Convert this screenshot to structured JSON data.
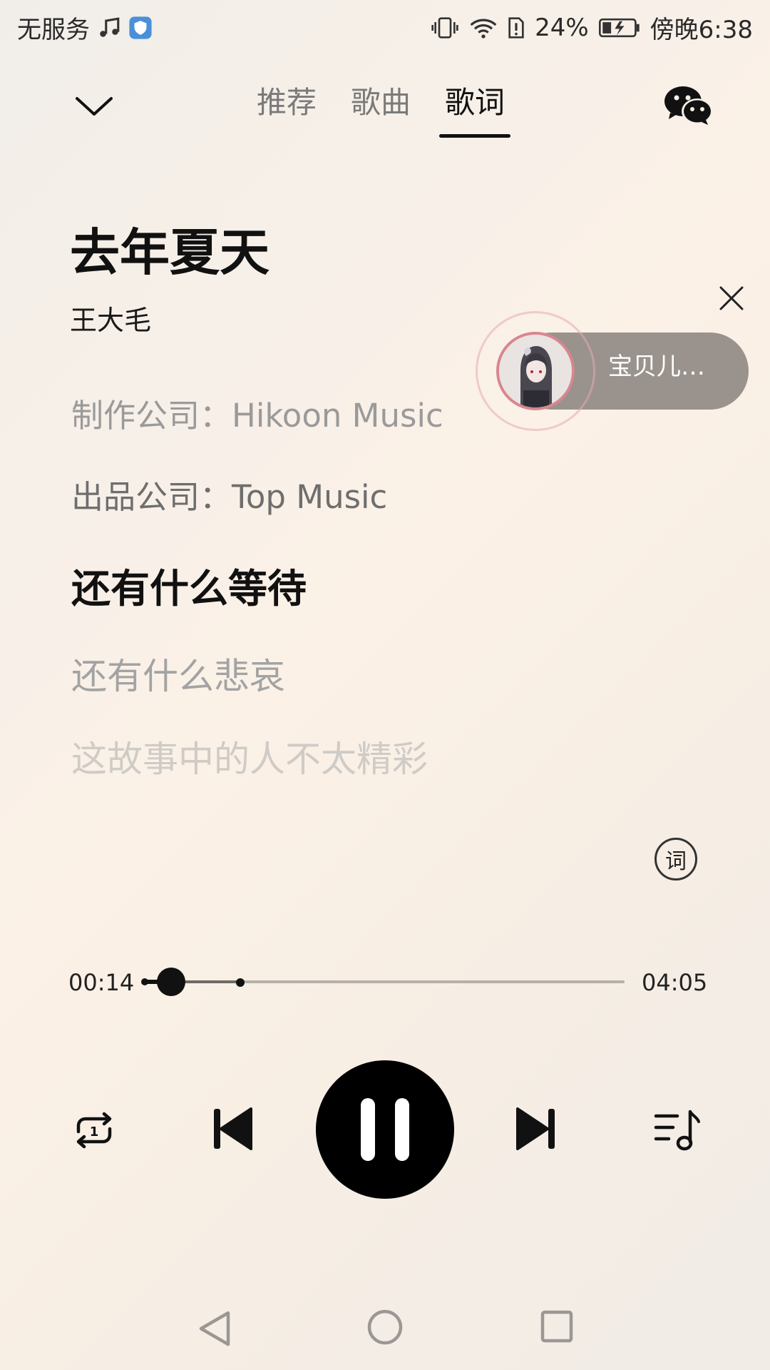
{
  "status_bar": {
    "carrier": "无服务",
    "battery_percent": "24%",
    "time": "傍晚6:38"
  },
  "tabs": [
    {
      "label": "推荐"
    },
    {
      "label": "歌曲"
    },
    {
      "label": "歌词"
    }
  ],
  "active_tab": "歌词",
  "song": {
    "title": "去年夏天",
    "artist": "王大毛",
    "credits": [
      "制作公司：Hikoon Music",
      "出品公司：Top Music"
    ]
  },
  "lyrics": {
    "current": "还有什么等待",
    "next": [
      "还有什么悲哀",
      "这故事中的人不太精彩"
    ]
  },
  "floating_player": {
    "title": "宝贝儿…"
  },
  "lyric_toggle_label": "词",
  "progress": {
    "elapsed": "00:14",
    "total": "04:05",
    "played_fraction": 0.057,
    "buffered_fraction": 0.2
  },
  "controls": {
    "repeat_mode_badge": "1"
  },
  "colors": {
    "accent": "#111111",
    "mini_player_bg": "#9a938d",
    "avatar_ring": "#d9868f"
  }
}
